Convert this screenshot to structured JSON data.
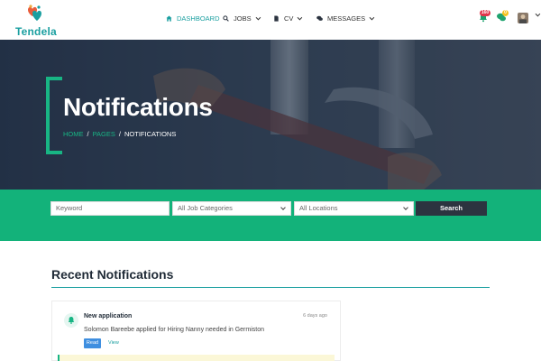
{
  "brand": {
    "name": "Tendela"
  },
  "nav": {
    "items": [
      {
        "label": "DASHBOARD",
        "icon": "home-icon",
        "active": true
      },
      {
        "label": "JOBS",
        "icon": "search-icon",
        "active": false
      },
      {
        "label": "CV",
        "icon": "document-icon",
        "active": false
      },
      {
        "label": "MESSAGES",
        "icon": "chat-icon",
        "active": false
      }
    ]
  },
  "header_icons": {
    "notifications_badge": "160",
    "messages_badge": "0"
  },
  "hero": {
    "title": "Notifications",
    "breadcrumb": [
      "HOME",
      "PAGES",
      "NOTIFICATIONS"
    ]
  },
  "search": {
    "keyword_placeholder": "Keyword",
    "category_selected": "All Job Categories",
    "location_selected": "All Locations",
    "button_label": "Search"
  },
  "section": {
    "title": "Recent Notifications"
  },
  "notifications": [
    {
      "title": "New application",
      "time": "6 days ago",
      "text": "Solomon Bareebe applied for Hiring Nanny needed in Germiston",
      "read_label": "Read",
      "view_label": "View"
    }
  ],
  "colors": {
    "accent_teal": "#1a9fa0",
    "accent_green": "#13b27a",
    "dark_button": "#2c3440",
    "badge_red": "#e2364b",
    "badge_yellow": "#f3c220"
  }
}
